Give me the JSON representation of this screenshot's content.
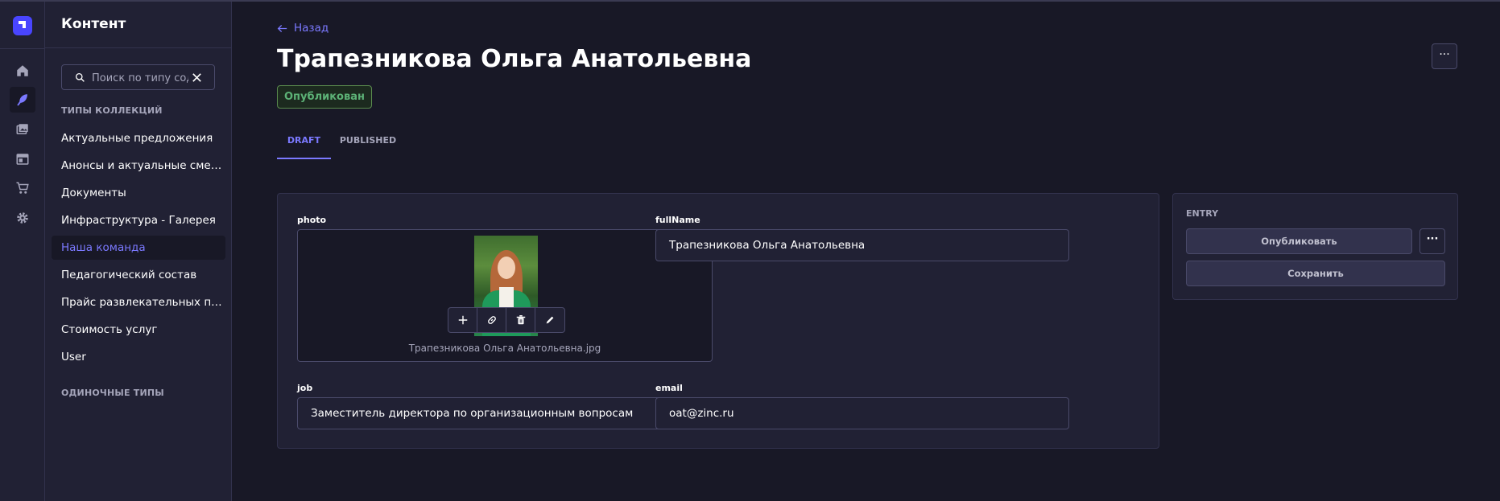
{
  "sidebar": {
    "title": "Контент",
    "search": {
      "placeholder": "Поиск по типу сод",
      "value": ""
    },
    "sections": {
      "collections": "ТИПЫ КОЛЛЕКЦИЙ",
      "singles": "ОДИНОЧНЫЕ ТИПЫ"
    },
    "items": [
      {
        "label": "Актуальные предложения"
      },
      {
        "label": "Анонсы и актуальные смены"
      },
      {
        "label": "Документы"
      },
      {
        "label": "Инфраструктура - Галерея"
      },
      {
        "label": "Наша команда"
      },
      {
        "label": "Педагогический состав"
      },
      {
        "label": "Прайс развлекательных программ"
      },
      {
        "label": "Стоимость услуг"
      },
      {
        "label": "User"
      }
    ],
    "active_item": "Наша команда"
  },
  "header": {
    "back_label": "Назад",
    "title": "Трапезникова Ольга Анатольевна",
    "status": "Опубликован",
    "more_label": "···"
  },
  "tabs": [
    {
      "label": "DRAFT",
      "active": true
    },
    {
      "label": "PUBLISHED",
      "active": false
    }
  ],
  "form": {
    "photo": {
      "label": "photo",
      "filename": "Трапезникова Ольга Анатольевна.jpg"
    },
    "fullName": {
      "label": "fullName",
      "value": "Трапезникова Ольга Анатольевна"
    },
    "job": {
      "label": "job",
      "value": "Заместитель директора по организационным вопросам"
    },
    "email": {
      "label": "email",
      "value": "oat@zinc.ru"
    }
  },
  "entry": {
    "label": "ENTRY",
    "publish_label": "Опубликовать",
    "more_label": "···",
    "save_label": "Сохранить"
  },
  "colors": {
    "background": "#181826",
    "panel": "#212134",
    "accent": "#7b79ff",
    "success": "#5cb176"
  }
}
